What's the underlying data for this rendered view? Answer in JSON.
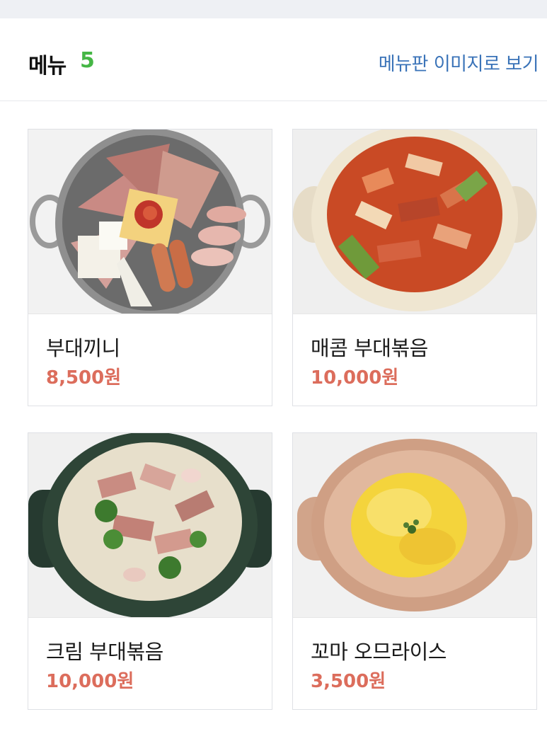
{
  "header": {
    "title": "메뉴",
    "count": "5",
    "view_menu_image_link": "메뉴판 이미지로 보기"
  },
  "menu_items": [
    {
      "name": "부대끼니",
      "price": "8,500원",
      "image": "budae-jjigae-pot-photo"
    },
    {
      "name": "매콤 부대볶음",
      "price": "10,000원",
      "image": "spicy-budae-stirfry-photo"
    },
    {
      "name": "크림 부대볶음",
      "price": "10,000원",
      "image": "cream-budae-stirfry-photo"
    },
    {
      "name": "꼬마 오므라이스",
      "price": "3,500원",
      "image": "mini-omurice-photo"
    }
  ],
  "colors": {
    "accent_count": "#45b645",
    "link": "#3a73b8",
    "price": "#dc6d5c",
    "background_strip": "#eef0f4"
  }
}
